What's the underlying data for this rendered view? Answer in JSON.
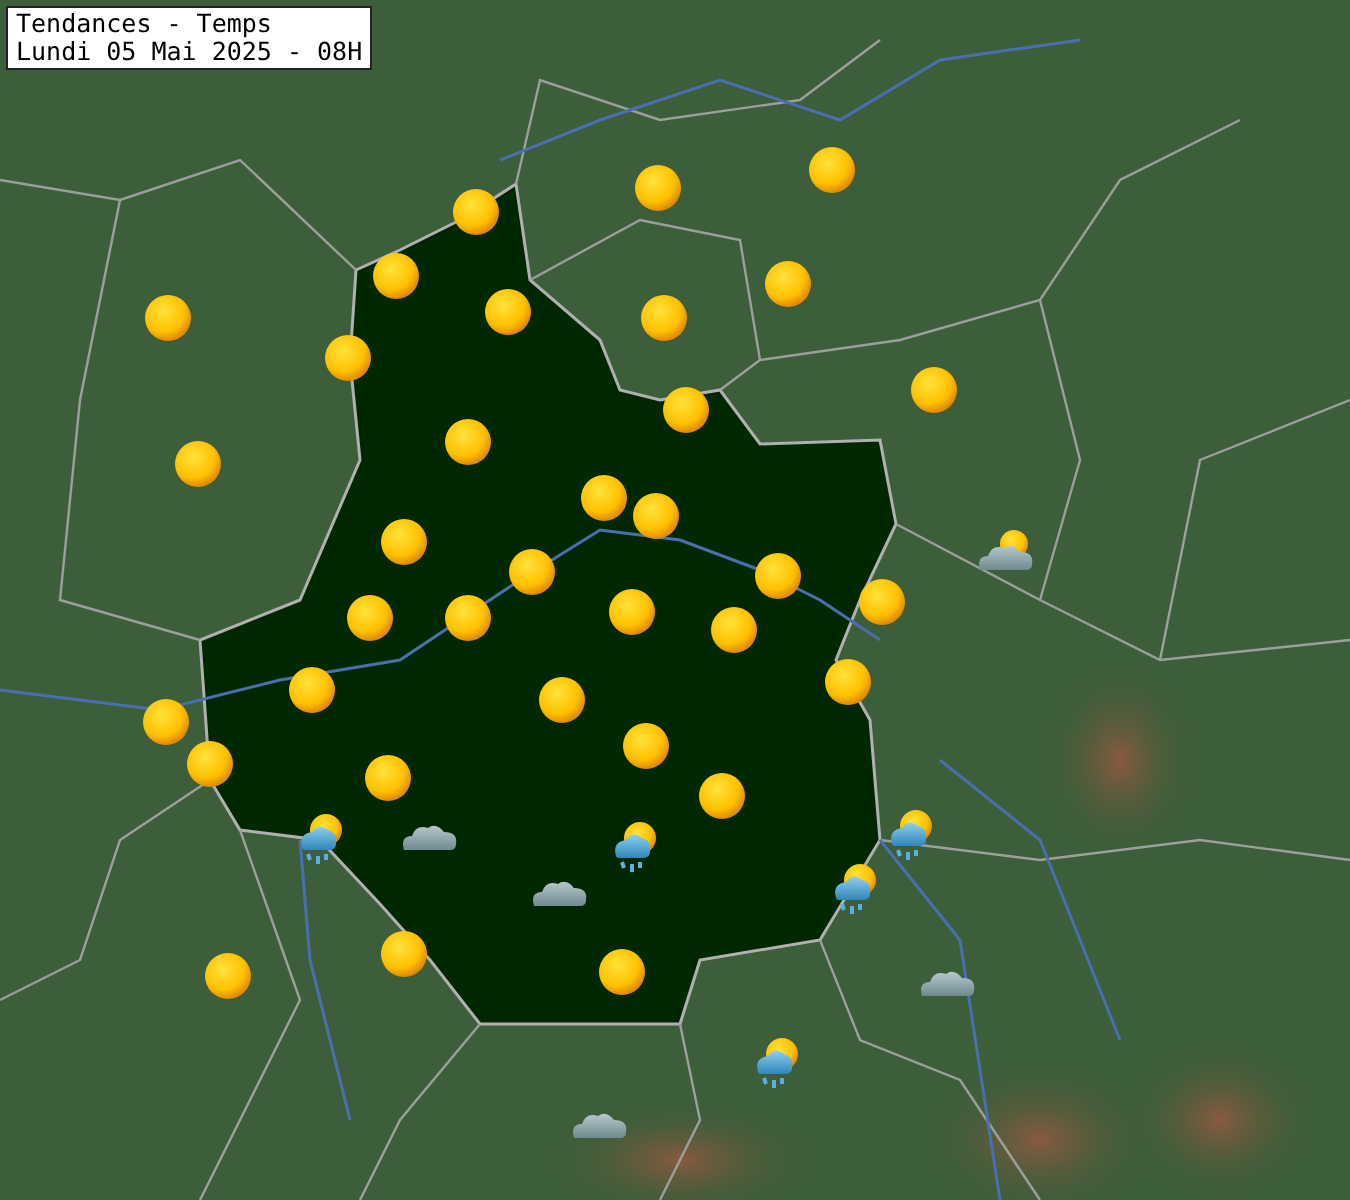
{
  "title": {
    "line_1": "Tendances - Temps",
    "line_2": "Lundi 05 Mai 2025 - 08H"
  },
  "markers": [
    {
      "kind": "sun"
    },
    {
      "kind": "sun"
    },
    {
      "kind": "sun"
    },
    {
      "kind": "sun"
    },
    {
      "kind": "sun"
    },
    {
      "kind": "sun"
    },
    {
      "kind": "sun"
    },
    {
      "kind": "sun"
    },
    {
      "kind": "sun"
    },
    {
      "kind": "sun"
    },
    {
      "kind": "sun"
    },
    {
      "kind": "sun"
    },
    {
      "kind": "sun"
    },
    {
      "kind": "sun"
    },
    {
      "kind": "sun"
    },
    {
      "kind": "sun"
    },
    {
      "kind": "sun"
    },
    {
      "kind": "sun"
    },
    {
      "kind": "sun"
    },
    {
      "kind": "sun"
    },
    {
      "kind": "sun"
    },
    {
      "kind": "sun"
    },
    {
      "kind": "sun"
    },
    {
      "kind": "sun"
    },
    {
      "kind": "sun"
    },
    {
      "kind": "sun"
    },
    {
      "kind": "sun"
    },
    {
      "kind": "sun"
    },
    {
      "kind": "sun"
    },
    {
      "kind": "sun"
    },
    {
      "kind": "sun"
    },
    {
      "kind": "sun"
    },
    {
      "kind": "sun"
    },
    {
      "kind": "sun"
    },
    {
      "kind": "shower"
    },
    {
      "kind": "shower"
    },
    {
      "kind": "shower"
    },
    {
      "kind": "shower"
    },
    {
      "kind": "shower"
    },
    {
      "kind": "cloud"
    },
    {
      "kind": "cloud"
    },
    {
      "kind": "cloud"
    },
    {
      "kind": "cloud"
    },
    {
      "kind": "partly_cloudy"
    }
  ]
}
